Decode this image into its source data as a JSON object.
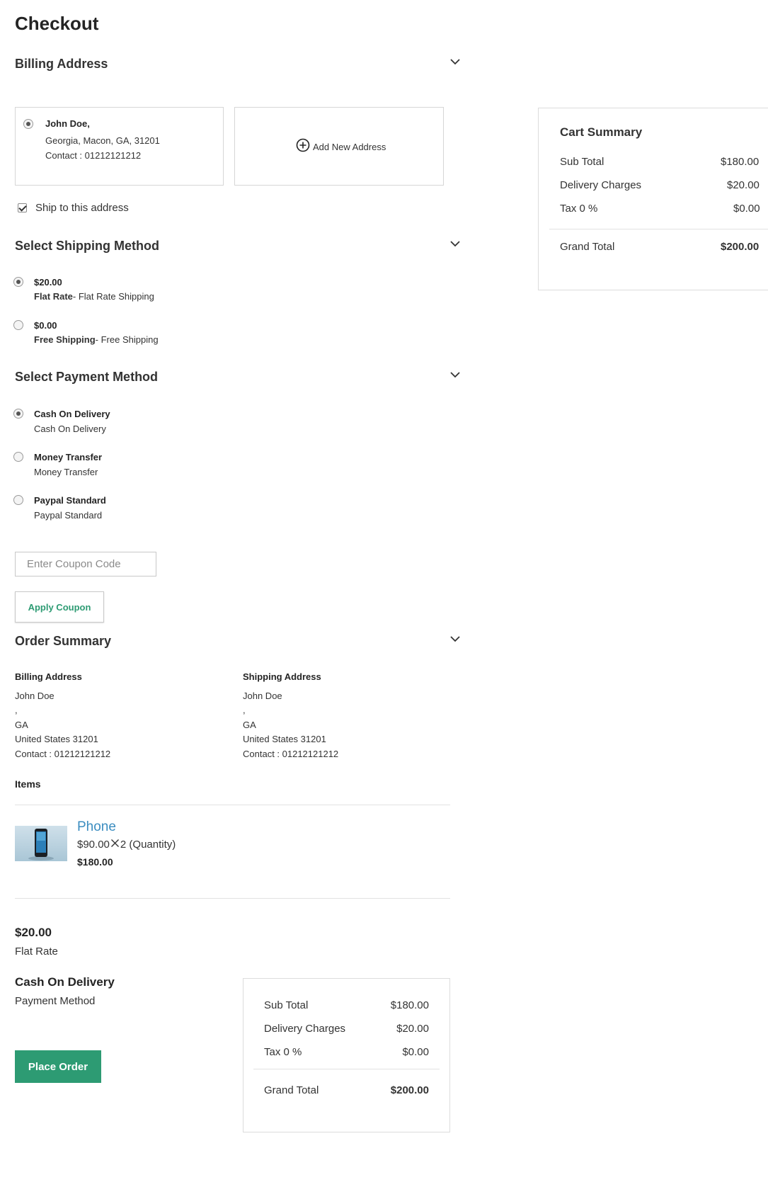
{
  "page": {
    "title": "Checkout"
  },
  "billing": {
    "section_title": "Billing Address",
    "address_card": {
      "name": "John Doe,",
      "line1": "Georgia, Macon, GA, 31201",
      "contact": "Contact : 01212121212",
      "selected": true
    },
    "add_new_label": "Add New Address",
    "ship_to_this_label": "Ship to this address",
    "ship_to_this_checked": true
  },
  "shipping": {
    "section_title": "Select Shipping Method",
    "options": [
      {
        "price": "$20.00",
        "name": "Flat Rate",
        "desc": "- Flat Rate Shipping",
        "selected": true
      },
      {
        "price": "$0.00",
        "name": "Free Shipping",
        "desc": "- Free Shipping",
        "selected": false
      }
    ]
  },
  "payment": {
    "section_title": "Select Payment Method",
    "options": [
      {
        "name": "Cash On Delivery",
        "desc": "Cash On Delivery",
        "selected": true
      },
      {
        "name": "Money Transfer",
        "desc": "Money Transfer",
        "selected": false
      },
      {
        "name": "Paypal Standard",
        "desc": "Paypal Standard",
        "selected": false
      }
    ]
  },
  "coupon": {
    "placeholder": "Enter Coupon Code",
    "value": "",
    "apply_label": "Apply Coupon"
  },
  "order_summary": {
    "section_title": "Order Summary",
    "billing": {
      "heading": "Billing Address",
      "name": "John Doe",
      "line2": ",",
      "state": "GA",
      "country_zip": "United States 31201",
      "contact": "Contact : 01212121212"
    },
    "shipping": {
      "heading": "Shipping Address",
      "name": "John Doe",
      "line2": ",",
      "state": "GA",
      "country_zip": "United States 31201",
      "contact": "Contact : 01212121212"
    },
    "items_heading": "Items",
    "items": [
      {
        "name": "Phone",
        "unit_price": "$90.00",
        "qty_text": "2 (Quantity)",
        "total": "$180.00"
      }
    ],
    "shipping_price": "$20.00",
    "shipping_name": "Flat Rate",
    "payment_name": "Cash On Delivery",
    "payment_label": "Payment Method",
    "place_order_label": "Place Order"
  },
  "totals": {
    "heading": "Cart Summary",
    "sub_total_label": "Sub Total",
    "sub_total": "$180.00",
    "delivery_label": "Delivery Charges",
    "delivery": "$20.00",
    "tax_label": "Tax 0 %",
    "tax": "$0.00",
    "grand_total_label": "Grand Total",
    "grand_total": "$200.00"
  },
  "colors": {
    "accent_green": "#2d9b73",
    "link_blue": "#3b8dc0"
  },
  "icons": {
    "section_toggle": "chevron-down-icon",
    "add_address": "plus-circle-icon",
    "quantity_multiply": "multiply-icon"
  }
}
